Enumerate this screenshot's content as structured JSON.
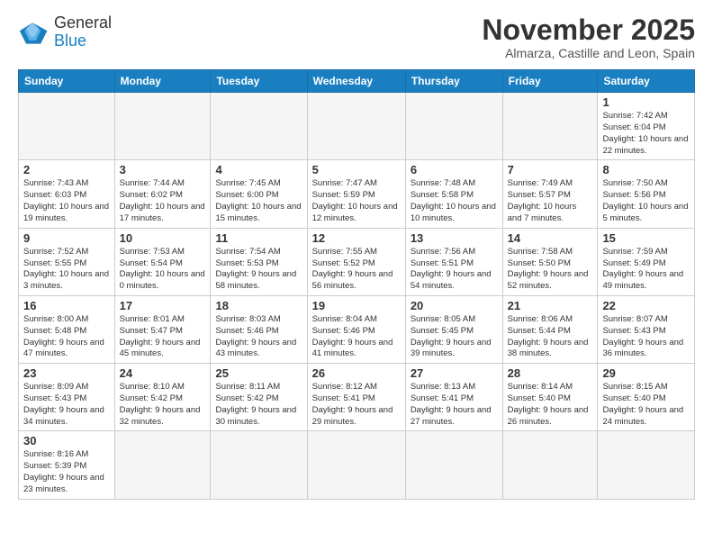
{
  "header": {
    "logo_line1": "General",
    "logo_line2": "Blue",
    "month": "November 2025",
    "location": "Almarza, Castille and Leon, Spain"
  },
  "days_of_week": [
    "Sunday",
    "Monday",
    "Tuesday",
    "Wednesday",
    "Thursday",
    "Friday",
    "Saturday"
  ],
  "weeks": [
    [
      {
        "num": "",
        "info": ""
      },
      {
        "num": "",
        "info": ""
      },
      {
        "num": "",
        "info": ""
      },
      {
        "num": "",
        "info": ""
      },
      {
        "num": "",
        "info": ""
      },
      {
        "num": "",
        "info": ""
      },
      {
        "num": "1",
        "info": "Sunrise: 7:42 AM\nSunset: 6:04 PM\nDaylight: 10 hours\nand 22 minutes."
      }
    ],
    [
      {
        "num": "2",
        "info": "Sunrise: 7:43 AM\nSunset: 6:03 PM\nDaylight: 10 hours\nand 19 minutes."
      },
      {
        "num": "3",
        "info": "Sunrise: 7:44 AM\nSunset: 6:02 PM\nDaylight: 10 hours\nand 17 minutes."
      },
      {
        "num": "4",
        "info": "Sunrise: 7:45 AM\nSunset: 6:00 PM\nDaylight: 10 hours\nand 15 minutes."
      },
      {
        "num": "5",
        "info": "Sunrise: 7:47 AM\nSunset: 5:59 PM\nDaylight: 10 hours\nand 12 minutes."
      },
      {
        "num": "6",
        "info": "Sunrise: 7:48 AM\nSunset: 5:58 PM\nDaylight: 10 hours\nand 10 minutes."
      },
      {
        "num": "7",
        "info": "Sunrise: 7:49 AM\nSunset: 5:57 PM\nDaylight: 10 hours\nand 7 minutes."
      },
      {
        "num": "8",
        "info": "Sunrise: 7:50 AM\nSunset: 5:56 PM\nDaylight: 10 hours\nand 5 minutes."
      }
    ],
    [
      {
        "num": "9",
        "info": "Sunrise: 7:52 AM\nSunset: 5:55 PM\nDaylight: 10 hours\nand 3 minutes."
      },
      {
        "num": "10",
        "info": "Sunrise: 7:53 AM\nSunset: 5:54 PM\nDaylight: 10 hours\nand 0 minutes."
      },
      {
        "num": "11",
        "info": "Sunrise: 7:54 AM\nSunset: 5:53 PM\nDaylight: 9 hours\nand 58 minutes."
      },
      {
        "num": "12",
        "info": "Sunrise: 7:55 AM\nSunset: 5:52 PM\nDaylight: 9 hours\nand 56 minutes."
      },
      {
        "num": "13",
        "info": "Sunrise: 7:56 AM\nSunset: 5:51 PM\nDaylight: 9 hours\nand 54 minutes."
      },
      {
        "num": "14",
        "info": "Sunrise: 7:58 AM\nSunset: 5:50 PM\nDaylight: 9 hours\nand 52 minutes."
      },
      {
        "num": "15",
        "info": "Sunrise: 7:59 AM\nSunset: 5:49 PM\nDaylight: 9 hours\nand 49 minutes."
      }
    ],
    [
      {
        "num": "16",
        "info": "Sunrise: 8:00 AM\nSunset: 5:48 PM\nDaylight: 9 hours\nand 47 minutes."
      },
      {
        "num": "17",
        "info": "Sunrise: 8:01 AM\nSunset: 5:47 PM\nDaylight: 9 hours\nand 45 minutes."
      },
      {
        "num": "18",
        "info": "Sunrise: 8:03 AM\nSunset: 5:46 PM\nDaylight: 9 hours\nand 43 minutes."
      },
      {
        "num": "19",
        "info": "Sunrise: 8:04 AM\nSunset: 5:46 PM\nDaylight: 9 hours\nand 41 minutes."
      },
      {
        "num": "20",
        "info": "Sunrise: 8:05 AM\nSunset: 5:45 PM\nDaylight: 9 hours\nand 39 minutes."
      },
      {
        "num": "21",
        "info": "Sunrise: 8:06 AM\nSunset: 5:44 PM\nDaylight: 9 hours\nand 38 minutes."
      },
      {
        "num": "22",
        "info": "Sunrise: 8:07 AM\nSunset: 5:43 PM\nDaylight: 9 hours\nand 36 minutes."
      }
    ],
    [
      {
        "num": "23",
        "info": "Sunrise: 8:09 AM\nSunset: 5:43 PM\nDaylight: 9 hours\nand 34 minutes."
      },
      {
        "num": "24",
        "info": "Sunrise: 8:10 AM\nSunset: 5:42 PM\nDaylight: 9 hours\nand 32 minutes."
      },
      {
        "num": "25",
        "info": "Sunrise: 8:11 AM\nSunset: 5:42 PM\nDaylight: 9 hours\nand 30 minutes."
      },
      {
        "num": "26",
        "info": "Sunrise: 8:12 AM\nSunset: 5:41 PM\nDaylight: 9 hours\nand 29 minutes."
      },
      {
        "num": "27",
        "info": "Sunrise: 8:13 AM\nSunset: 5:41 PM\nDaylight: 9 hours\nand 27 minutes."
      },
      {
        "num": "28",
        "info": "Sunrise: 8:14 AM\nSunset: 5:40 PM\nDaylight: 9 hours\nand 26 minutes."
      },
      {
        "num": "29",
        "info": "Sunrise: 8:15 AM\nSunset: 5:40 PM\nDaylight: 9 hours\nand 24 minutes."
      }
    ],
    [
      {
        "num": "30",
        "info": "Sunrise: 8:16 AM\nSunset: 5:39 PM\nDaylight: 9 hours\nand 23 minutes."
      },
      {
        "num": "",
        "info": ""
      },
      {
        "num": "",
        "info": ""
      },
      {
        "num": "",
        "info": ""
      },
      {
        "num": "",
        "info": ""
      },
      {
        "num": "",
        "info": ""
      },
      {
        "num": "",
        "info": ""
      }
    ]
  ]
}
